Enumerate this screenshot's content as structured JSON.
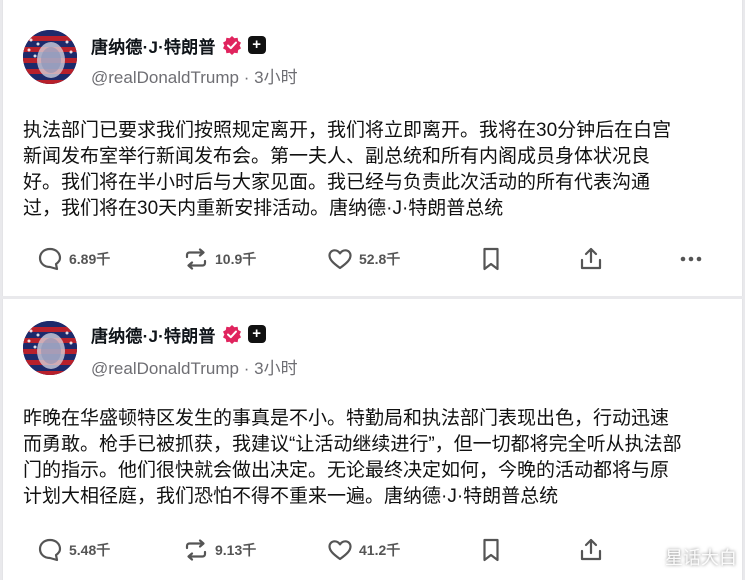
{
  "posts": [
    {
      "author_name": "唐纳德·J·特朗普",
      "handle": "@realDonaldTrump",
      "time": "3小时",
      "text": "执法部门已要求我们按照规定离开，我们将立即离开。我将在30分钟后在白宫\n新闻发布室举行新闻发布会。第一夫人、副总统和所有内阁成员身体状况良\n好。我们将在半小时后与大家见面。我已经与负责此次活动的所有代表沟通\n过，我们将在30天内重新安排活动。唐纳德·J·特朗普总统",
      "replies": "6.89千",
      "reposts": "10.9千",
      "likes": "52.8千"
    },
    {
      "author_name": "唐纳德·J·特朗普",
      "handle": "@realDonaldTrump",
      "time": "3小时",
      "text": "昨晚在华盛顿特区发生的事真是不小。特勤局和执法部门表现出色，行动迅速\n而勇敢。枪手已被抓获，我建议“让活动继续进行”，但一切都将完全听从执法部\n门的指示。他们很快就会做出决定。无论最终决定如何，今晚的活动都将与原\n计划大相径庭，我们恐怕不得不重来一遍。唐纳德·J·特朗普总统",
      "replies": "5.48千",
      "reposts": "9.13千",
      "likes": "41.2千"
    }
  ],
  "separator": "·",
  "watermark": "星话大白",
  "colors": {
    "verified_badge": "#e0245e",
    "text_secondary": "#6e6e73",
    "icon": "#555555"
  },
  "icons": [
    "reply-icon",
    "repost-icon",
    "like-icon",
    "bookmark-icon",
    "share-icon",
    "more-icon",
    "verified-icon",
    "plus-icon"
  ]
}
